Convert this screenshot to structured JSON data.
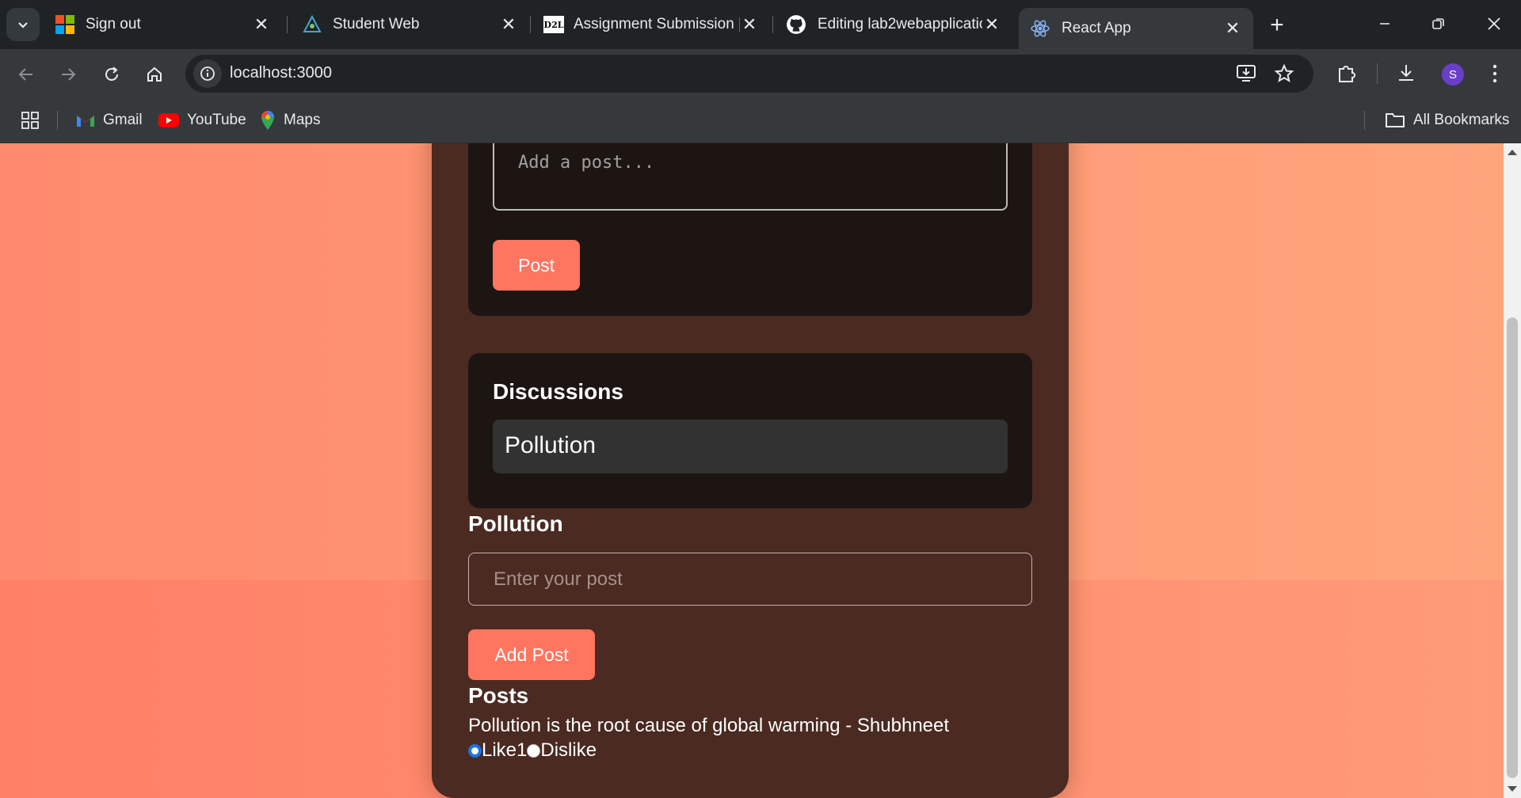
{
  "browser": {
    "tabs": [
      {
        "title": "Sign out",
        "icon": "microsoft-icon"
      },
      {
        "title": "Student Web",
        "icon": "student-web-icon"
      },
      {
        "title": "Assignment Submission |",
        "icon": "d2l-icon",
        "icon_text": "D2L"
      },
      {
        "title": "Editing lab2webapplicatio",
        "icon": "github-icon"
      },
      {
        "title": "React App",
        "icon": "react-icon",
        "active": true
      }
    ],
    "url": "localhost:3000",
    "profile_initial": "S",
    "bookmarks": [
      {
        "label": "Gmail",
        "icon": "gmail-icon"
      },
      {
        "label": "YouTube",
        "icon": "youtube-icon"
      },
      {
        "label": "Maps",
        "icon": "maps-icon"
      }
    ],
    "all_bookmarks_label": "All Bookmarks"
  },
  "page": {
    "composer": {
      "placeholder": "Add a post...",
      "post_button": "Post"
    },
    "discussions": {
      "title": "Discussions",
      "items": [
        "Pollution"
      ]
    },
    "topic": {
      "title": "Pollution",
      "input_placeholder": "Enter your post",
      "add_button": "Add Post"
    },
    "posts": {
      "title": "Posts",
      "items": [
        {
          "text": "Pollution is the root cause of global warming - Shubhneet",
          "like_label": "Like",
          "like_count": "1",
          "dislike_label": "Dislike",
          "selected": "like"
        }
      ]
    }
  },
  "colors": {
    "accent": "#ff7560",
    "card": "#4a2a21",
    "panel": "#1d1512"
  }
}
